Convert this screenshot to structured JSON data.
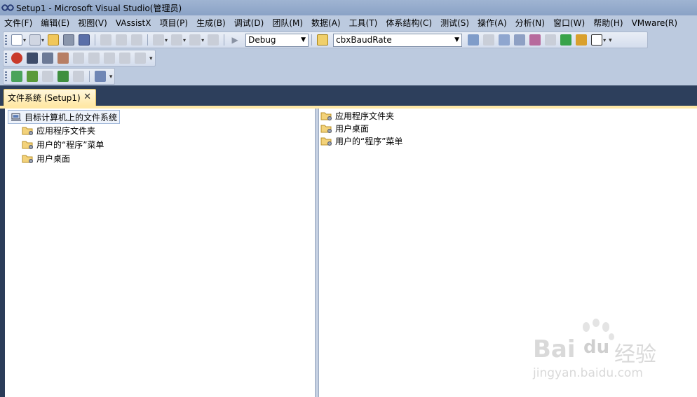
{
  "window": {
    "title": "Setup1 - Microsoft Visual Studio(管理员)"
  },
  "menu": {
    "items": [
      {
        "label": "文件(F)"
      },
      {
        "label": "编辑(E)"
      },
      {
        "label": "视图(V)"
      },
      {
        "label": "VAssistX"
      },
      {
        "label": "项目(P)"
      },
      {
        "label": "生成(B)"
      },
      {
        "label": "调试(D)"
      },
      {
        "label": "团队(M)"
      },
      {
        "label": "数据(A)"
      },
      {
        "label": "工具(T)"
      },
      {
        "label": "体系结构(C)"
      },
      {
        "label": "测试(S)"
      },
      {
        "label": "操作(A)"
      },
      {
        "label": "分析(N)"
      },
      {
        "label": "窗口(W)"
      },
      {
        "label": "帮助(H)"
      },
      {
        "label": "VMware(R)"
      }
    ]
  },
  "toolbar": {
    "config_value": "Debug",
    "find_value": "cbxBaudRate"
  },
  "document_tab": {
    "label": "文件系统 (Setup1)",
    "close_glyph": "✕"
  },
  "file_system_tree": {
    "root_label": "目标计算机上的文件系统",
    "children": [
      {
        "label": "应用程序文件夹"
      },
      {
        "label": "用户的“程序”菜单"
      },
      {
        "label": "用户桌面"
      }
    ]
  },
  "folder_list": {
    "items": [
      {
        "label": "应用程序文件夹"
      },
      {
        "label": "用户桌面"
      },
      {
        "label": "用户的“程序”菜单"
      }
    ]
  },
  "watermark": {
    "line1": "Bai",
    "line1b": "du",
    "line1c": "经验",
    "line2": "jingyan.baidu.com"
  },
  "colors": {
    "ide_background": "#2b3c59",
    "tab_active": "#ffe8a6",
    "toolbar": "#bccadf",
    "menubar": "#bccadf"
  }
}
